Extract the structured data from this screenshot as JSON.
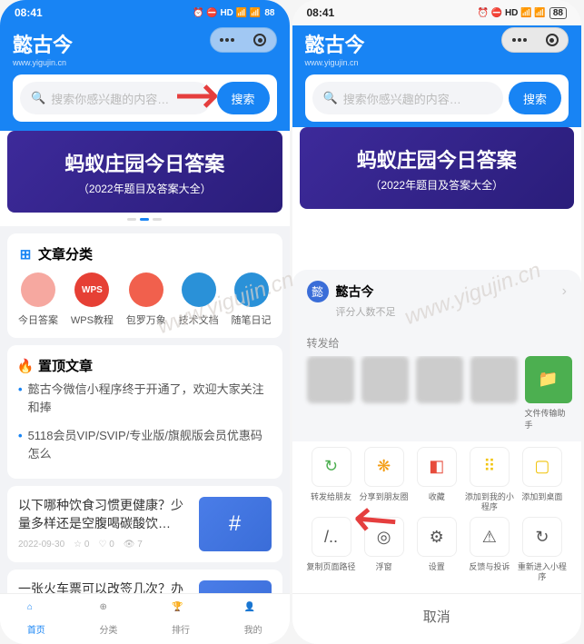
{
  "status": {
    "time": "08:41",
    "battery": "88",
    "icons": "⏰ ⛔ HD 📶 📶"
  },
  "app": {
    "title": "懿古今",
    "subtitle": "www.yigujin.cn"
  },
  "search": {
    "placeholder": "搜索你感兴趣的内容…",
    "button": "搜索"
  },
  "banner": {
    "title": "蚂蚁庄园今日答案",
    "subtitle": "（2022年题目及答案大全）"
  },
  "categories": {
    "heading": "文章分类",
    "items": [
      {
        "label": "今日答案",
        "color": "#f6a8a0"
      },
      {
        "label": "WPS教程",
        "color": "#e64035",
        "text": "WPS Office"
      },
      {
        "label": "包罗万象",
        "color": "#f1604d"
      },
      {
        "label": "技术文档",
        "color": "#2a91d8"
      },
      {
        "label": "随笔日记",
        "color": "#2a91d8"
      }
    ]
  },
  "pinned": {
    "heading": "置顶文章",
    "items": [
      "懿古今微信小程序终于开通了，欢迎大家关注和捧",
      "5118会员VIP/SVIP/专业版/旗舰版会员优惠码怎么"
    ]
  },
  "articles": [
    {
      "title": "以下哪种饮食习惯更健康？少量多样还是空腹喝碳酸饮…",
      "date": "2022-09-30",
      "likes": "0",
      "hearts": "0",
      "views": "7"
    },
    {
      "title": "一张火车票可以改签几次？办理多少次改签？什么是改签？"
    }
  ],
  "tabs": [
    {
      "label": "首页",
      "active": true
    },
    {
      "label": "分类",
      "active": false
    },
    {
      "label": "排行",
      "active": false
    },
    {
      "label": "我的",
      "active": false
    }
  ],
  "sheet": {
    "name": "懿古今",
    "rating": "评分人数不足",
    "forward": "转发给",
    "file_helper": "文件传输助手",
    "actions": [
      {
        "label": "转发给朋友",
        "icon": "↻",
        "color": "#4caf50"
      },
      {
        "label": "分享到朋友圈",
        "icon": "❋",
        "color": "#f39c12"
      },
      {
        "label": "收藏",
        "icon": "◧",
        "color": "#e74c3c"
      },
      {
        "label": "添加到我的小程序",
        "icon": "⠿",
        "color": "#f1c40f"
      },
      {
        "label": "添加到桌面",
        "icon": "▢",
        "color": "#f1c40f"
      },
      {
        "label": "复制页面路径",
        "icon": "/..",
        "color": "#555"
      },
      {
        "label": "浮窗",
        "icon": "◎",
        "color": "#555"
      },
      {
        "label": "设置",
        "icon": "⚙",
        "color": "#555"
      },
      {
        "label": "反馈与投诉",
        "icon": "⚠",
        "color": "#555"
      },
      {
        "label": "重新进入小程序",
        "icon": "↻",
        "color": "#555"
      }
    ],
    "cancel": "取消"
  },
  "watermark": "www.yigujin.cn"
}
